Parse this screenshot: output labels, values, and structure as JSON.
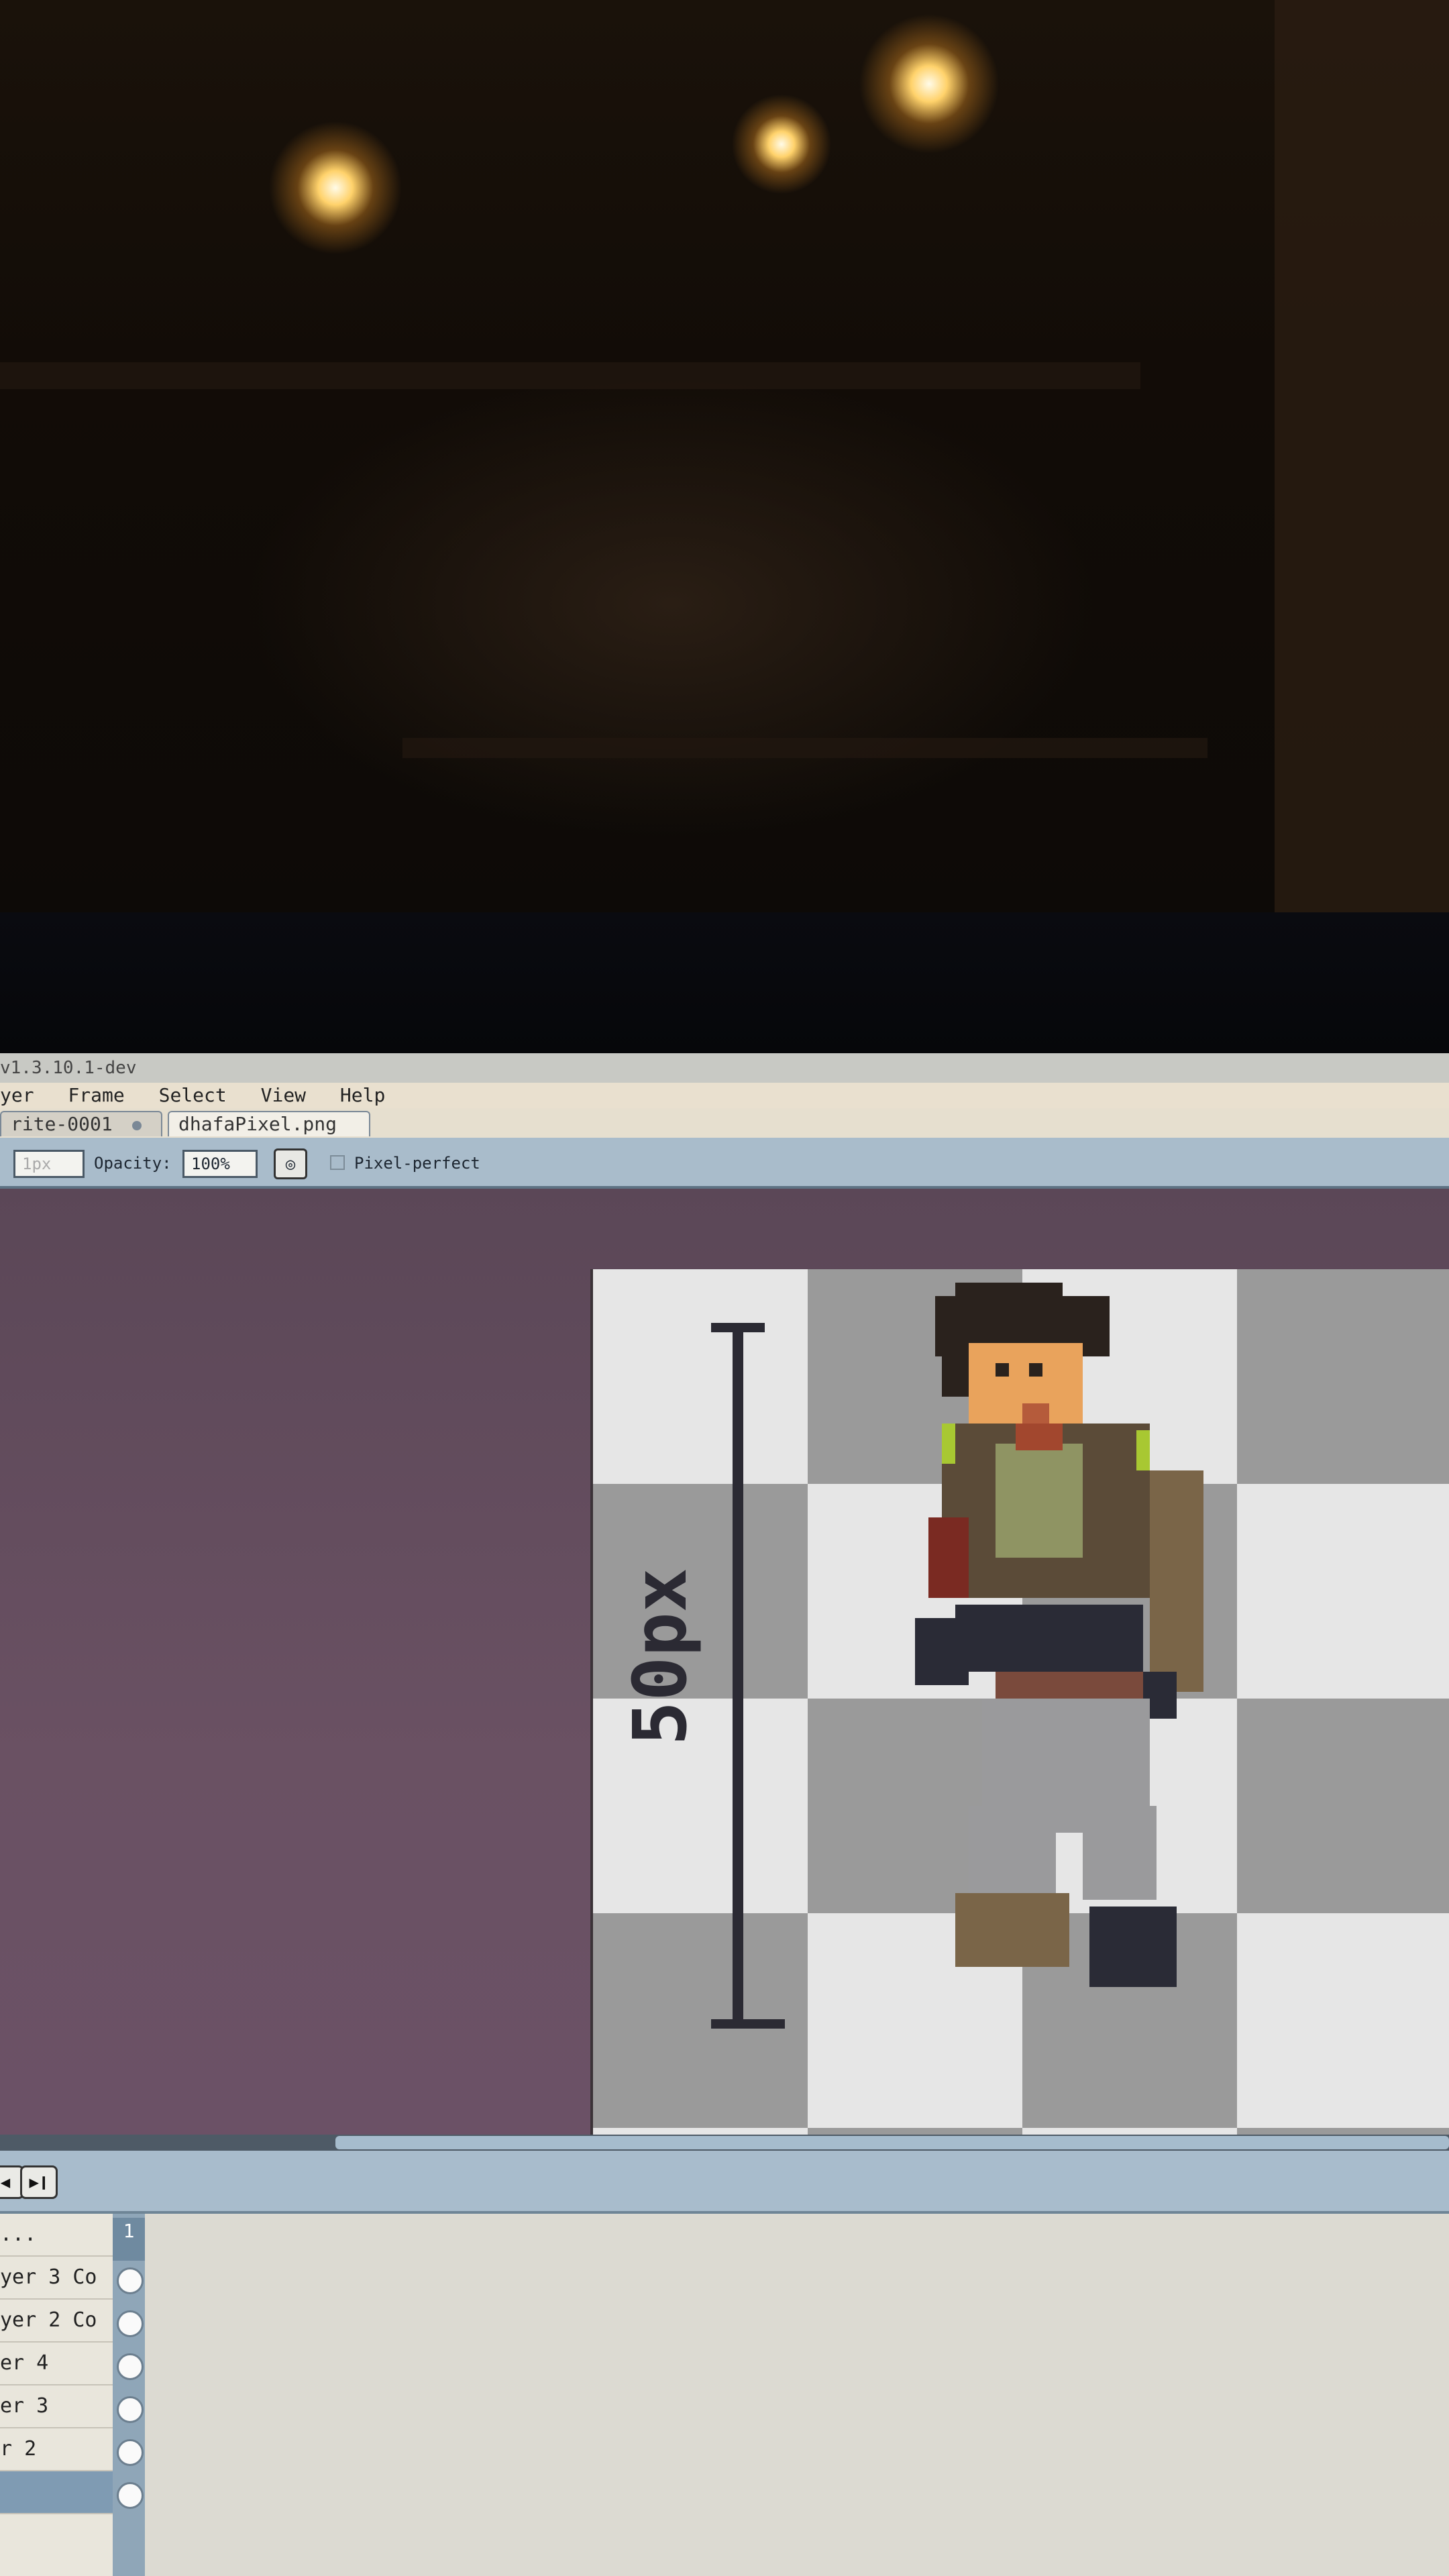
{
  "window": {
    "title": "v1.3.10.1-dev"
  },
  "menu": {
    "items": [
      "yer",
      "Frame",
      "Select",
      "View",
      "Help"
    ]
  },
  "tabs": [
    {
      "label": "rite-0001",
      "active": false
    },
    {
      "label": "dhafaPixel.png",
      "active": true,
      "close": "×"
    }
  ],
  "toolbar": {
    "size_value": "1px",
    "opacity_label": "Opacity:",
    "opacity_value": "100%",
    "pixel_perfect_label": "Pixel-perfect"
  },
  "canvas": {
    "ruler_label": "50px",
    "checker_colors": [
      "#e4e4e4",
      "#9a9a9a"
    ]
  },
  "timeline": {
    "buttons": [
      "play-icon"
    ],
    "frame_number": "1",
    "layers": [
      {
        "name": "..."
      },
      {
        "name": "yer 3 Co"
      },
      {
        "name": "yer 2 Co"
      },
      {
        "name": "er 4"
      },
      {
        "name": "er 3"
      },
      {
        "name": "r 2"
      },
      {
        "name": ""
      }
    ]
  },
  "colors": {
    "editor_bg": "#6a5163",
    "toolbar_bg": "#a9bccb",
    "accent": "#5e7384"
  }
}
